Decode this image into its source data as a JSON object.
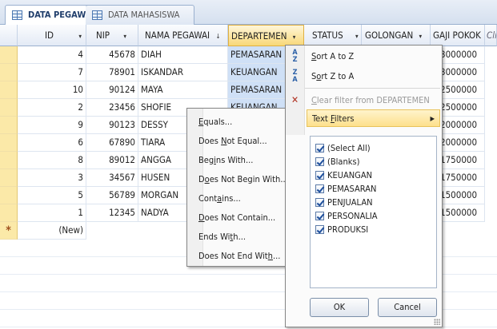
{
  "tabs": [
    {
      "label": "DATA PEGAWAI",
      "active": true
    },
    {
      "label": "DATA MAHASISWA",
      "active": false
    }
  ],
  "columns": [
    {
      "label": "ID",
      "arrow": "▾"
    },
    {
      "label": "NIP",
      "arrow": "▾"
    },
    {
      "label": "NAMA PEGAWAI",
      "arrow": "↓"
    },
    {
      "label": "DEPARTEMEN",
      "arrow": "▾"
    },
    {
      "label": "STATUS",
      "arrow": "▾"
    },
    {
      "label": "GOLONGAN",
      "arrow": "▾"
    },
    {
      "label": "GAJI POKOK",
      "arrow": "↓"
    },
    {
      "label": "Cli",
      "arrow": ""
    }
  ],
  "rows": [
    {
      "id": "4",
      "nip": "45678",
      "nama": "DIAH",
      "dept": "PEMASARAN",
      "gaji": "3000000"
    },
    {
      "id": "7",
      "nip": "78901",
      "nama": "ISKANDAR",
      "dept": "KEUANGAN",
      "gaji": "3000000"
    },
    {
      "id": "10",
      "nip": "90124",
      "nama": "MAYA",
      "dept": "PEMASARAN",
      "gaji": "2500000"
    },
    {
      "id": "2",
      "nip": "23456",
      "nama": "SHOFIE",
      "dept": "KEUANGAN",
      "gaji": "2500000"
    },
    {
      "id": "9",
      "nip": "90123",
      "nama": "DESSY",
      "dept": "",
      "gaji": "2000000"
    },
    {
      "id": "6",
      "nip": "67890",
      "nama": "TIARA",
      "dept": "",
      "gaji": "2000000"
    },
    {
      "id": "8",
      "nip": "89012",
      "nama": "ANGGA",
      "dept": "",
      "gaji": "1750000"
    },
    {
      "id": "3",
      "nip": "34567",
      "nama": "HUSEN",
      "dept": "",
      "gaji": "1750000"
    },
    {
      "id": "5",
      "nip": "56789",
      "nama": "MORGAN",
      "dept": "",
      "gaji": "1500000"
    },
    {
      "id": "1",
      "nip": "12345",
      "nama": "NADYA",
      "dept": "",
      "gaji": "1500000"
    }
  ],
  "new_row": {
    "marker": "*",
    "label": "(New)"
  },
  "text_filters_menu": [
    {
      "pre": "",
      "u": "E",
      "post": "quals..."
    },
    {
      "pre": "Does ",
      "u": "N",
      "post": "ot Equal..."
    },
    {
      "pre": "Beg",
      "u": "i",
      "post": "ns With..."
    },
    {
      "pre": "D",
      "u": "o",
      "post": "es Not Begin With..."
    },
    {
      "pre": "Cont",
      "u": "a",
      "post": "ins..."
    },
    {
      "pre": "",
      "u": "D",
      "post": "oes Not Contain..."
    },
    {
      "pre": "Ends Wi",
      "u": "t",
      "post": "h..."
    },
    {
      "pre": "Does Not End Wit",
      "u": "h",
      "post": "..."
    }
  ],
  "filter_dropdown": {
    "sort_az": {
      "u": "S",
      "post": "ort A to Z",
      "icon": "A↓Z"
    },
    "sort_za": {
      "pre": "S",
      "u": "o",
      "post": "rt Z to A",
      "icon": "Z↓A"
    },
    "clear_filter": {
      "u": "C",
      "post": "lear filter from DEPARTEMEN"
    },
    "text_filters": {
      "pre": "Text ",
      "u": "F",
      "post": "ilters",
      "arrow": "▶"
    },
    "values": [
      "(Select All)",
      "(Blanks)",
      "KEUANGAN",
      "PEMASARAN",
      "PENJUALAN",
      "PERSONALIA",
      "PRODUKSI"
    ],
    "ok_label": "OK",
    "cancel_label": "Cancel"
  }
}
